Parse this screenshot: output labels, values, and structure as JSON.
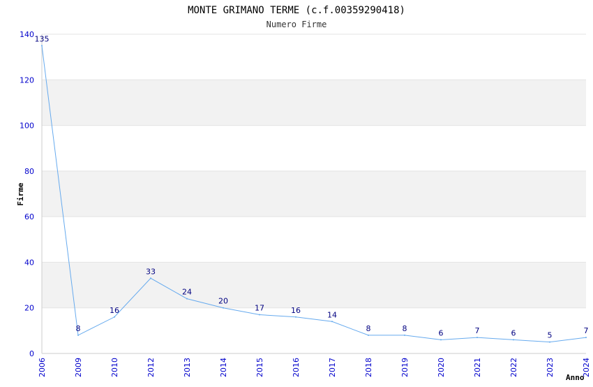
{
  "chart_data": {
    "type": "line",
    "title": "MONTE GRIMANO TERME (c.f.00359290418)",
    "subtitle": "Numero Firme",
    "xlabel": "Anno",
    "ylabel": "Firme",
    "categories": [
      "2006",
      "2009",
      "2010",
      "2012",
      "2013",
      "2014",
      "2015",
      "2016",
      "2017",
      "2018",
      "2019",
      "2020",
      "2021",
      "2022",
      "2023",
      "2024"
    ],
    "series": [
      {
        "values": [
          135,
          8,
          16,
          33,
          24,
          20,
          17,
          16,
          14,
          8,
          8,
          6,
          7,
          6,
          5,
          7
        ]
      }
    ],
    "ylim": [
      0,
      140
    ],
    "yticks": [
      0,
      20,
      40,
      60,
      80,
      100,
      120,
      140
    ],
    "grid": true,
    "colors": {
      "line": "#66aaee",
      "band": "#f2f2f2",
      "tick_text": "#0000cc",
      "data_label": "#000080"
    }
  }
}
